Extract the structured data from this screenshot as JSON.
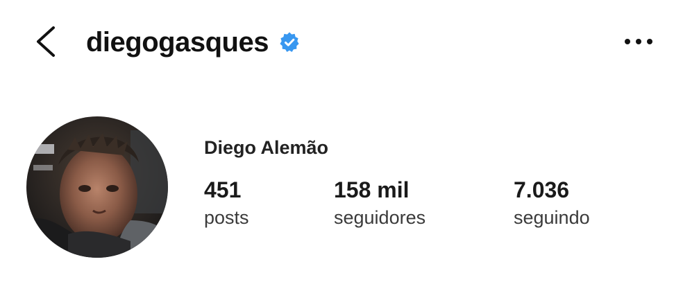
{
  "header": {
    "back_icon": "chevron-left-icon",
    "username": "diegogasques",
    "verified_icon": "verified-badge-icon",
    "more_icon": "more-horizontal-icon"
  },
  "profile": {
    "display_name": "Diego Alemão",
    "avatar_icon": "profile-photo"
  },
  "stats": [
    {
      "count": "451",
      "label": "posts"
    },
    {
      "count": "158 mil",
      "label": "seguidores"
    },
    {
      "count": "7.036",
      "label": "seguindo"
    }
  ],
  "colors": {
    "verified": "#3897f0",
    "text": "#111111",
    "background": "#ffffff"
  }
}
